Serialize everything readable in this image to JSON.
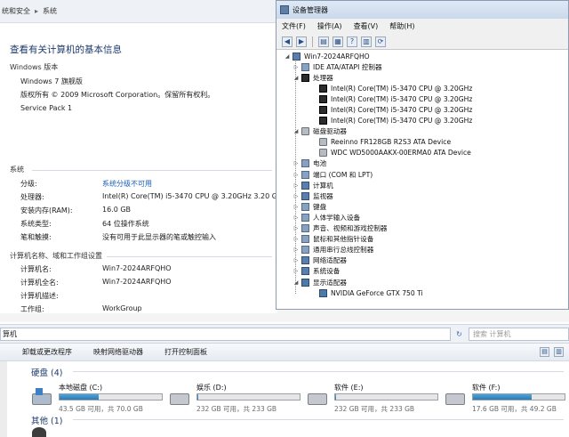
{
  "system": {
    "breadcrumb": [
      "统和安全",
      "系统"
    ],
    "heading": "查看有关计算机的基本信息",
    "edition_section": "Windows 版本",
    "edition": "Windows 7 旗舰版",
    "copyright": "版权所有 © 2009 Microsoft Corporation。保留所有权利。",
    "service_pack": "Service Pack 1",
    "system_section": "系统",
    "rows": [
      {
        "label": "分级:",
        "value": "系统分级不可用",
        "link": true
      },
      {
        "label": "处理器:",
        "value": "Intel(R) Core(TM) i5-3470 CPU @ 3.20GHz   3.20 GHz",
        "link": false
      },
      {
        "label": "安装内存(RAM):",
        "value": "16.0 GB",
        "link": false
      },
      {
        "label": "系统类型:",
        "value": "64 位操作系统",
        "link": false
      },
      {
        "label": "笔和触摸:",
        "value": "没有可用于此显示器的笔或触控输入",
        "link": false
      }
    ],
    "network_section": "计算机名称、域和工作组设置",
    "net_rows": [
      {
        "label": "计算机名:",
        "value": "Win7-2024ARFQHO"
      },
      {
        "label": "计算机全名:",
        "value": "Win7-2024ARFQHO"
      },
      {
        "label": "计算机描述:",
        "value": ""
      },
      {
        "label": "工作组:",
        "value": "WorkGroup"
      }
    ]
  },
  "devmgr": {
    "title": "设备管理器",
    "menu": [
      "文件(F)",
      "操作(A)",
      "查看(V)",
      "帮助(H)"
    ],
    "toolbar_icons": [
      "back-icon",
      "forward-icon",
      "properties-icon",
      "help-icon",
      "console-icon",
      "scan-icon"
    ],
    "root": "Win7-2024ARFQHO",
    "nodes": [
      {
        "label": "IDE ATA/ATAPI 控制器",
        "level": 1,
        "expander": "▷",
        "icon": "gen"
      },
      {
        "label": "处理器",
        "level": 1,
        "expander": "◢",
        "icon": "cpu"
      },
      {
        "label": "Intel(R) Core(TM) i5-3470 CPU @ 3.20GHz",
        "level": 2,
        "expander": "",
        "icon": "cpu"
      },
      {
        "label": "Intel(R) Core(TM) i5-3470 CPU @ 3.20GHz",
        "level": 2,
        "expander": "",
        "icon": "cpu"
      },
      {
        "label": "Intel(R) Core(TM) i5-3470 CPU @ 3.20GHz",
        "level": 2,
        "expander": "",
        "icon": "cpu"
      },
      {
        "label": "Intel(R) Core(TM) i5-3470 CPU @ 3.20GHz",
        "level": 2,
        "expander": "",
        "icon": "cpu"
      },
      {
        "label": "磁盘驱动器",
        "level": 1,
        "expander": "◢",
        "icon": "disk"
      },
      {
        "label": "Reeinno FR128GB R2S3 ATA Device",
        "level": 2,
        "expander": "",
        "icon": "disk"
      },
      {
        "label": "WDC WD5000AAKX-00ERMA0 ATA Device",
        "level": 2,
        "expander": "",
        "icon": "disk"
      },
      {
        "label": "电池",
        "level": 1,
        "expander": "▷",
        "icon": "gen"
      },
      {
        "label": "端口 (COM 和 LPT)",
        "level": 1,
        "expander": "▷",
        "icon": "gen"
      },
      {
        "label": "计算机",
        "level": 1,
        "expander": "▷",
        "icon": "pc"
      },
      {
        "label": "监视器",
        "level": 1,
        "expander": "▷",
        "icon": "pc"
      },
      {
        "label": "键盘",
        "level": 1,
        "expander": "▷",
        "icon": "gen"
      },
      {
        "label": "人体学输入设备",
        "level": 1,
        "expander": "▷",
        "icon": "gen"
      },
      {
        "label": "声音、视频和游戏控制器",
        "level": 1,
        "expander": "▷",
        "icon": "gen"
      },
      {
        "label": "鼠标和其他指针设备",
        "level": 1,
        "expander": "▷",
        "icon": "gen"
      },
      {
        "label": "通用串行总线控制器",
        "level": 1,
        "expander": "▷",
        "icon": "gen"
      },
      {
        "label": "网络适配器",
        "level": 1,
        "expander": "▷",
        "icon": "pc"
      },
      {
        "label": "系统设备",
        "level": 1,
        "expander": "▷",
        "icon": "pc"
      },
      {
        "label": "显示适配器",
        "level": 1,
        "expander": "◢",
        "icon": "gpu"
      },
      {
        "label": "NVIDIA GeForce GTX 750 Ti",
        "level": 2,
        "expander": "",
        "icon": "gpu"
      }
    ]
  },
  "explorer": {
    "address": "算机",
    "search_placeholder": "搜索 计算机",
    "commands": [
      "卸载或更改程序",
      "映射网络驱动器",
      "打开控制面板"
    ],
    "hdd_group": "硬盘 (4)",
    "other_group": "其他 (1)",
    "drives": [
      {
        "name": "本地磁盘 (C:)",
        "free": "43.5 GB 可用，共 70.0 GB",
        "used_fraction": 0.38,
        "system": true
      },
      {
        "name": "娱乐 (D:)",
        "free": "232 GB 可用，共 233 GB",
        "used_fraction": 0.01,
        "system": false
      },
      {
        "name": "软件 (E:)",
        "free": "232 GB 可用，共 233 GB",
        "used_fraction": 0.01,
        "system": false
      },
      {
        "name": "软件 (F:)",
        "free": "17.6 GB 可用，共 49.2 GB",
        "used_fraction": 0.64,
        "system": false
      }
    ]
  }
}
